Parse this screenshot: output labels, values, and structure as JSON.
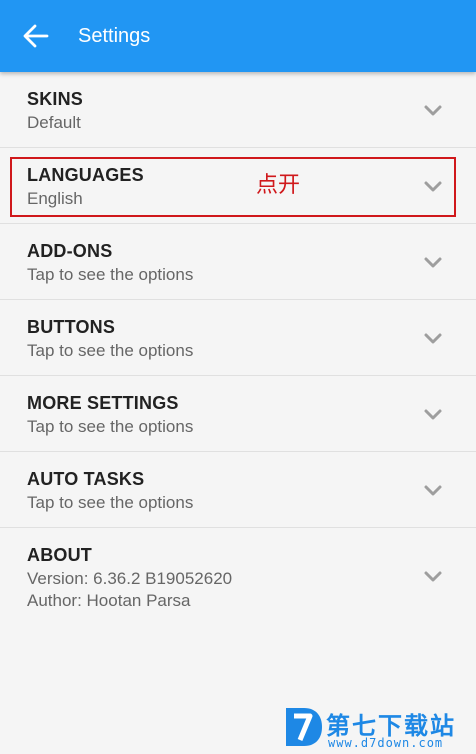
{
  "appbar": {
    "title": "Settings",
    "back_icon": "arrow-left-icon",
    "color": "#2196f3"
  },
  "settings": [
    {
      "title": "SKINS",
      "subtitle": "Default"
    },
    {
      "title": "LANGUAGES",
      "subtitle": "English"
    },
    {
      "title": "ADD-ONS",
      "subtitle": "Tap to see the options"
    },
    {
      "title": "BUTTONS",
      "subtitle": "Tap to see the options"
    },
    {
      "title": "MORE SETTINGS",
      "subtitle": "Tap to see the options"
    },
    {
      "title": "AUTO TASKS",
      "subtitle": "Tap to see the options"
    },
    {
      "title": "ABOUT",
      "subtitle": "Version: 6.36.2  B19052620",
      "subtitle2": "Author: Hootan Parsa"
    }
  ],
  "annotation": {
    "text": "点开",
    "color": "#d0181b"
  },
  "watermark": {
    "text": "第七下载站",
    "url": "www.d7down.com",
    "color": "#1e88e5"
  }
}
